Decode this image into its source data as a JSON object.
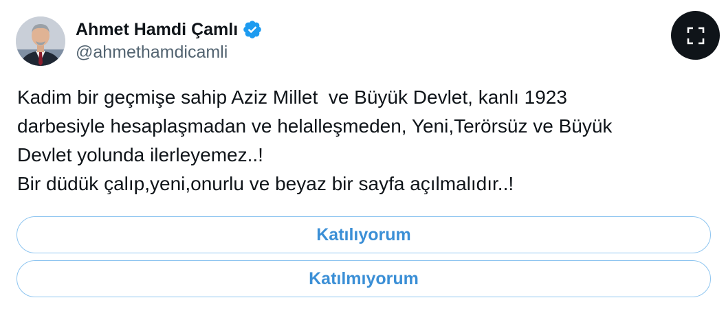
{
  "author": {
    "display_name": "Ahmet Hamdi Çamlı",
    "handle": "@ahmethamdicamli",
    "verified": true,
    "verified_color": "#1d9bf0"
  },
  "tweet": {
    "lines": [
      "Kadim bir geçmişe sahip Aziz Millet  ve Büyük Devlet, kanlı 1923",
      "darbesiyle hesaplaşmadan ve helalleşmeden, Yeni,Terörsüz ve Büyük",
      "Devlet yolunda ilerleyemez..!",
      "Bir düdük çalıp,yeni,onurlu ve beyaz bir sayfa açılmalıdır..!"
    ]
  },
  "poll": {
    "options": [
      {
        "label": "Katılıyorum"
      },
      {
        "label": "Katılmıyorum"
      }
    ],
    "accent_color": "#3b8fd6"
  },
  "icons": {
    "expand": "expand-icon",
    "verified": "verified-badge-icon",
    "avatar": "profile-photo"
  }
}
